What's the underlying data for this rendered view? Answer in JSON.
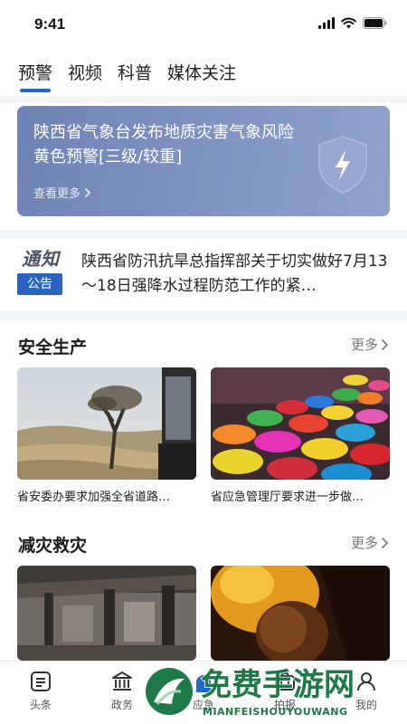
{
  "status": {
    "time": "9:41"
  },
  "tabs": [
    {
      "label": "预警",
      "active": true
    },
    {
      "label": "视频",
      "active": false
    },
    {
      "label": "科普",
      "active": false
    },
    {
      "label": "媒体关注",
      "active": false
    }
  ],
  "alert": {
    "text": "陕西省气象台发布地质灾害气象风险黄色预警[三级/较重]",
    "more_label": "查看更多"
  },
  "notice": {
    "logo_word": "通知",
    "badge": "公告",
    "text": "陕西省防汛抗旱总指挥部关于切实做好7月13～18日强降水过程防范工作的紧…"
  },
  "sections": [
    {
      "title": "安全生产",
      "more_label": "更多",
      "cards": [
        {
          "caption": "省安委办要求加强全省道路…"
        },
        {
          "caption": "省应急管理厅要求进一步做…"
        }
      ]
    },
    {
      "title": "减灾救灾",
      "more_label": "更多",
      "cards": [
        {
          "caption": ""
        },
        {
          "caption": ""
        }
      ]
    }
  ],
  "bottom_nav": [
    {
      "label": "头条",
      "icon": "news-icon"
    },
    {
      "label": "政务",
      "icon": "government-icon"
    },
    {
      "label": "应急",
      "icon": "emergency-icon"
    },
    {
      "label": "拍报",
      "icon": "camera-icon"
    },
    {
      "label": "我的",
      "icon": "profile-icon"
    }
  ],
  "watermark": {
    "title": "免费手游网",
    "subtitle": "MIANFEISHOUYOUWANG"
  },
  "colors": {
    "accent": "#2266d4",
    "alert_bg": "#7f93c2",
    "notice_badge": "#2c63c3"
  }
}
